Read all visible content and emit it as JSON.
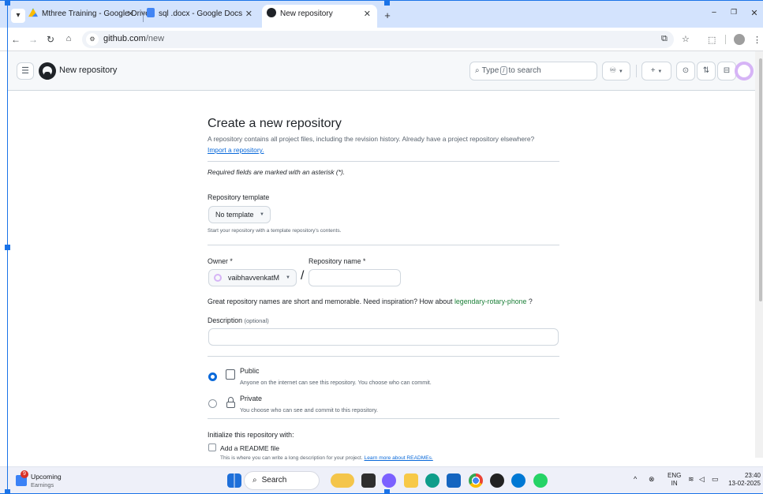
{
  "browser": {
    "tabs": [
      {
        "title": "Mthree Training - Google Drive"
      },
      {
        "title": "sql .docx - Google Docs"
      },
      {
        "title": "New repository"
      }
    ],
    "url_host": "github.com",
    "url_path": "/new"
  },
  "header": {
    "page_title": "New repository",
    "search_prefix": "Type",
    "search_key": "/",
    "search_suffix": "to search"
  },
  "form": {
    "heading": "Create a new repository",
    "intro": "A repository contains all project files, including the revision history. Already have a project repository elsewhere?",
    "import_link": "Import a repository.",
    "required_note": "Required fields are marked with an asterisk (*).",
    "template_label": "Repository template",
    "template_value": "No template",
    "template_help": "Start your repository with a template repository's contents.",
    "owner_label": "Owner *",
    "owner_value": "vaibhavvenkatM",
    "repo_name_label": "Repository name *",
    "repo_name_value": "",
    "slash": "/",
    "name_hint_prefix": "Great repository names are short and memorable. Need inspiration? How about",
    "name_suggestion": "legendary-rotary-phone",
    "name_hint_suffix": "?",
    "description_label": "Description",
    "description_optional": "(optional)",
    "description_value": "",
    "visibility": [
      {
        "title": "Public",
        "desc": "Anyone on the internet can see this repository. You choose who can commit.",
        "selected": true
      },
      {
        "title": "Private",
        "desc": "You choose who can see and commit to this repository.",
        "selected": false
      }
    ],
    "init_label": "Initialize this repository with:",
    "readme_label": "Add a README file",
    "readme_help": "This is where you can write a long description for your project.",
    "readme_link": "Learn more about READMEs."
  },
  "taskbar": {
    "widget_title": "Upcoming",
    "widget_subtitle": "Earnings",
    "widget_badge": "9",
    "search_label": "Search",
    "lang_top": "ENG",
    "lang_bottom": "IN",
    "time": "23:40",
    "date": "13-02-2025"
  },
  "colors": {
    "accent": "#0969da",
    "suggestion": "#1a7f37",
    "selection": "#1a73e8"
  }
}
